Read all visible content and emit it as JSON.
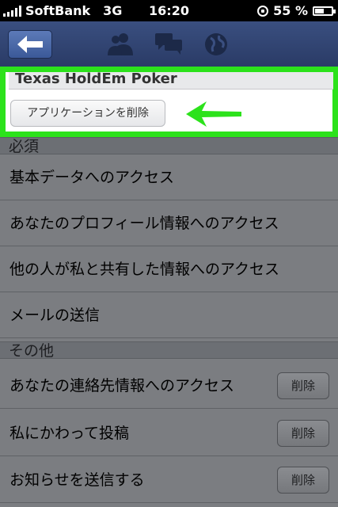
{
  "status_bar": {
    "carrier": "SoftBank",
    "network": "3G",
    "time": "16:20",
    "battery": "55 %",
    "battery_level": 0.55
  },
  "navbar": {
    "back_icon": "arrow-left-icon",
    "icons": [
      "friends-icon",
      "messages-icon",
      "globe-icon"
    ]
  },
  "app": {
    "name": "Texas HoldEm Poker",
    "remove_label": "アプリケーションを削除",
    "highlight_color": "#2ce21b"
  },
  "sections": {
    "required": {
      "title": "必須",
      "items": [
        "基本データへのアクセス",
        "あなたのプロフィール情報へのアクセス",
        "他の人が私と共有した情報へのアクセス",
        "メールの送信"
      ]
    },
    "other": {
      "title": "その他",
      "items": [
        {
          "label": "あなたの連絡先情報へのアクセス",
          "button": "削除"
        },
        {
          "label": "私にかわって投稿",
          "button": "削除"
        },
        {
          "label": "お知らせを送信する",
          "button": "削除"
        }
      ]
    }
  }
}
